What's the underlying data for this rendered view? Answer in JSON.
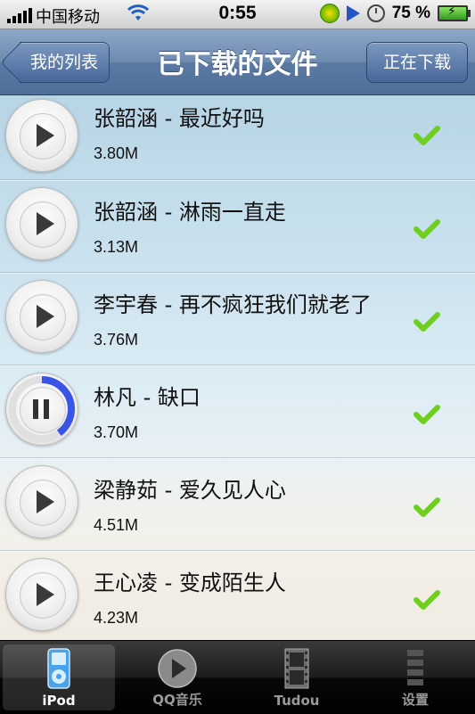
{
  "status_bar": {
    "carrier": "中国移动",
    "time": "0:55",
    "battery_percent": "75 %"
  },
  "nav": {
    "back_label": "我的列表",
    "title": "已下载的文件",
    "right_label": "正在下载"
  },
  "songs": [
    {
      "title": "张韶涵 - 最近好吗",
      "size": "3.80M",
      "state": "play",
      "downloaded": true
    },
    {
      "title": "张韶涵 - 淋雨一直走",
      "size": "3.13M",
      "state": "play",
      "downloaded": true
    },
    {
      "title": "李宇春 - 再不疯狂我们就老了",
      "size": "3.76M",
      "state": "play",
      "downloaded": true
    },
    {
      "title": "林凡 - 缺口",
      "size": "3.70M",
      "state": "pause",
      "progress": 0.4,
      "downloaded": true
    },
    {
      "title": "梁静茹 - 爱久见人心",
      "size": "4.51M",
      "state": "play",
      "downloaded": true
    },
    {
      "title": "王心凌 - 变成陌生人",
      "size": "4.23M",
      "state": "play",
      "downloaded": true
    }
  ],
  "tabs": [
    {
      "label": "iPod",
      "icon": "ipod-icon",
      "active": true
    },
    {
      "label": "QQ音乐",
      "icon": "qq-music-play-icon",
      "active": false
    },
    {
      "label": "Tudou",
      "icon": "film-strip-icon",
      "active": false
    },
    {
      "label": "设置",
      "icon": "settings-icon",
      "active": false
    }
  ],
  "colors": {
    "nav_blue": "#5b7aa3",
    "check_green": "#6fcf1f",
    "progress_blue": "#3a55e6"
  }
}
